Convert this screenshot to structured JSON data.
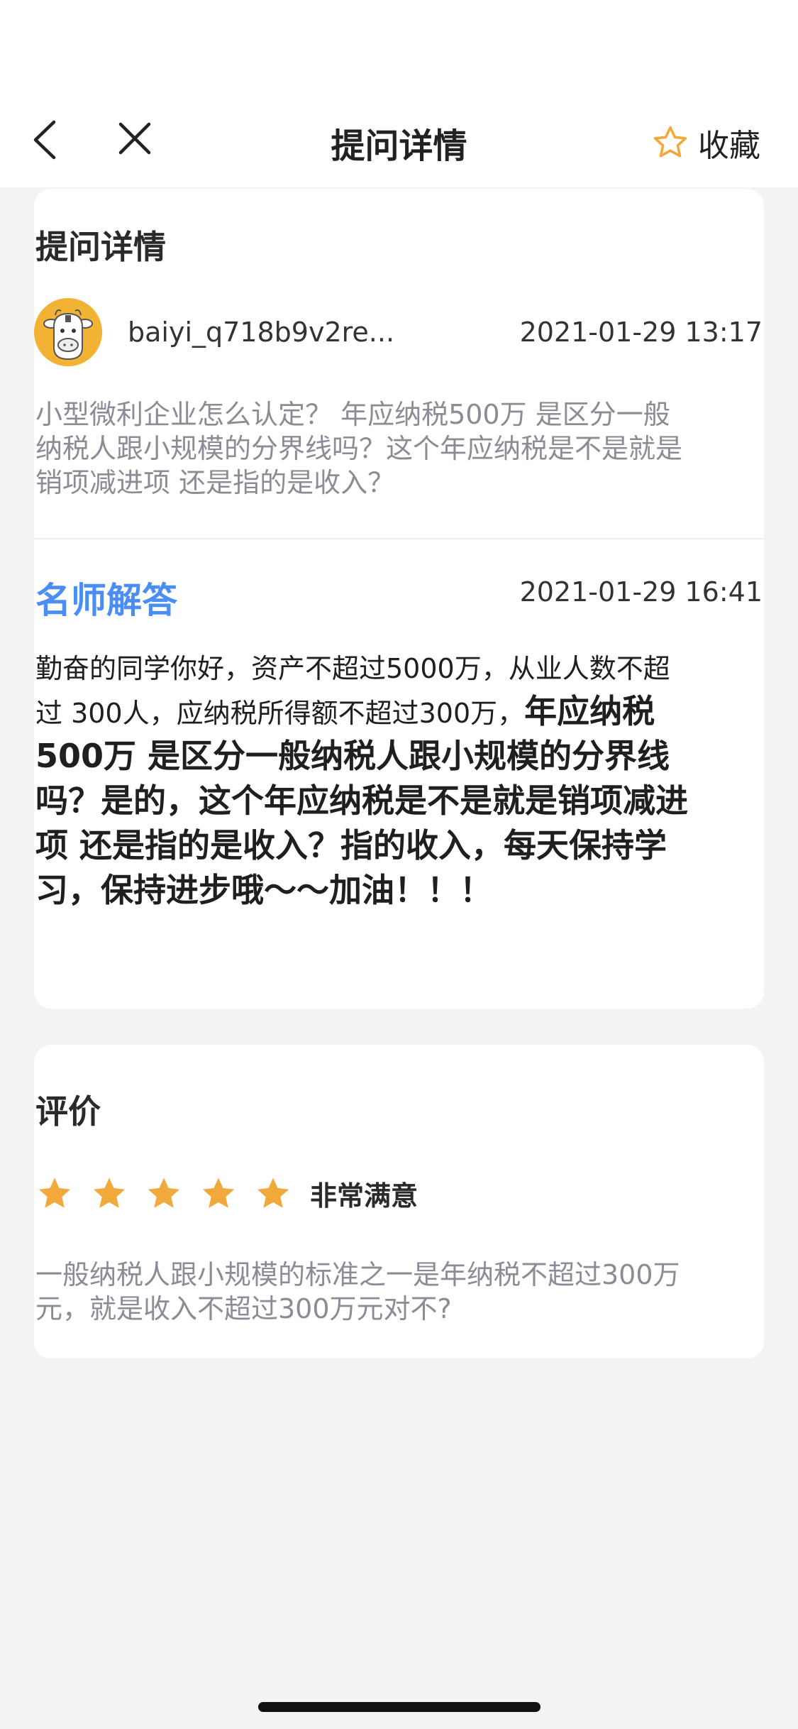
{
  "header": {
    "title": "提问详情",
    "favorite_label": "收藏",
    "icons": {
      "back": "chevron-left-icon",
      "close": "close-icon",
      "favorite": "star-outline-icon"
    }
  },
  "question": {
    "section_title": "提问详情",
    "username": "baiyi_q718b9v2re...",
    "time": "2021-01-29 13:17",
    "text": "小型微利企业怎么认定？ 年应纳税500万 是区分一般纳税人跟小规模的分界线吗？这个年应纳税是不是就是销项减进项 还是指的是收入？"
  },
  "answer": {
    "section_title": "名师解答",
    "time": "2021-01-29 16:41",
    "text_normal": "勤奋的同学你好，资产不超过5000万，从业人数不超过 300人，应纳税所得额不超过300万，",
    "text_bold": "年应纳税500万 是区分一般纳税人跟小规模的分界线吗？是的，这个年应纳税是不是就是销项减进项 还是指的是收入？指的收入，每天保持学习，保持进步哦～～加油！！！"
  },
  "rating": {
    "section_title": "评价",
    "stars": 5,
    "max_stars": 5,
    "label": "非常满意",
    "comment": "一般纳税人跟小规模的标准之一是年纳税不超过300万元，就是收入不超过300万元对不?"
  },
  "colors": {
    "accent_blue": "#4a8df5",
    "star_orange": "#f2a93b",
    "background": "#f3f3f6"
  }
}
